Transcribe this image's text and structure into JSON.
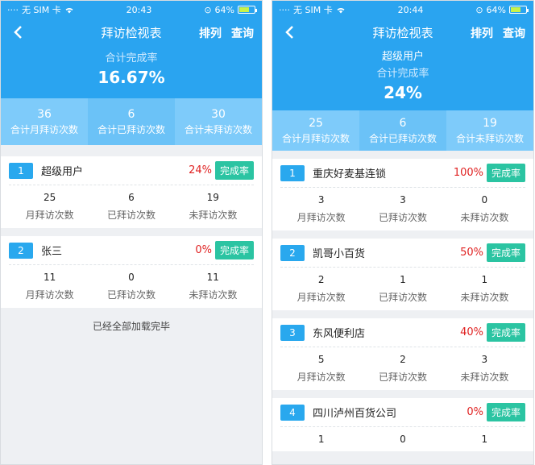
{
  "left": {
    "status": {
      "carrier": "无 SIM 卡",
      "time": "20:43",
      "battery": "64%"
    },
    "nav": {
      "title": "拜访检视表",
      "sort": "排列",
      "query": "查询",
      "back": "‹"
    },
    "summary": {
      "label": "合计完成率",
      "rate": "16.67%"
    },
    "stats": [
      {
        "num": "36",
        "label": "合计月拜访次数"
      },
      {
        "num": "6",
        "label": "合计已拜访次数"
      },
      {
        "num": "30",
        "label": "合计未拜访次数"
      }
    ],
    "cards": [
      {
        "idx": "1",
        "name": "超级用户",
        "rate": "24%",
        "btn": "完成率",
        "stats": [
          {
            "n": "25",
            "l": "月拜访次数"
          },
          {
            "n": "6",
            "l": "已拜访次数"
          },
          {
            "n": "19",
            "l": "未拜访次数"
          }
        ]
      },
      {
        "idx": "2",
        "name": "张三",
        "rate": "0%",
        "btn": "完成率",
        "stats": [
          {
            "n": "11",
            "l": "月拜访次数"
          },
          {
            "n": "0",
            "l": "已拜访次数"
          },
          {
            "n": "11",
            "l": "未拜访次数"
          }
        ]
      }
    ],
    "footer": "已经全部加载完毕"
  },
  "right": {
    "status": {
      "carrier": "无 SIM 卡",
      "time": "20:44",
      "battery": "64%"
    },
    "nav": {
      "title": "拜访检视表",
      "sort": "排列",
      "query": "查询",
      "back": "‹"
    },
    "summary": {
      "user": "超级用户",
      "label": "合计完成率",
      "rate": "24%"
    },
    "stats": [
      {
        "num": "25",
        "label": "合计月拜访次数"
      },
      {
        "num": "6",
        "label": "合计已拜访次数"
      },
      {
        "num": "19",
        "label": "合计未拜访次数"
      }
    ],
    "cards": [
      {
        "idx": "1",
        "name": "重庆好麦基连锁",
        "rate": "100%",
        "btn": "完成率",
        "stats": [
          {
            "n": "3",
            "l": "月拜访次数"
          },
          {
            "n": "3",
            "l": "已拜访次数"
          },
          {
            "n": "0",
            "l": "未拜访次数"
          }
        ]
      },
      {
        "idx": "2",
        "name": "凯哥小百货",
        "rate": "50%",
        "btn": "完成率",
        "stats": [
          {
            "n": "2",
            "l": "月拜访次数"
          },
          {
            "n": "1",
            "l": "已拜访次数"
          },
          {
            "n": "1",
            "l": "未拜访次数"
          }
        ]
      },
      {
        "idx": "3",
        "name": "东风便利店",
        "rate": "40%",
        "btn": "完成率",
        "stats": [
          {
            "n": "5",
            "l": "月拜访次数"
          },
          {
            "n": "2",
            "l": "已拜访次数"
          },
          {
            "n": "3",
            "l": "未拜访次数"
          }
        ]
      },
      {
        "idx": "4",
        "name": "四川泸州百货公司",
        "rate": "0%",
        "btn": "完成率",
        "stats": [
          {
            "n": "1",
            "l": ""
          },
          {
            "n": "0",
            "l": ""
          },
          {
            "n": "1",
            "l": ""
          }
        ]
      }
    ]
  },
  "colors": {
    "primary": "#2aa4f0",
    "stats_bg": "#7ecbfa",
    "rate_red": "#e02222",
    "button_green": "#2bc4a2",
    "index_blue": "#29a8ee"
  },
  "icons": {
    "back": "chevron-left-icon",
    "wifi": "wifi-icon",
    "battery": "battery-icon",
    "lock": "orientation-lock-icon"
  }
}
